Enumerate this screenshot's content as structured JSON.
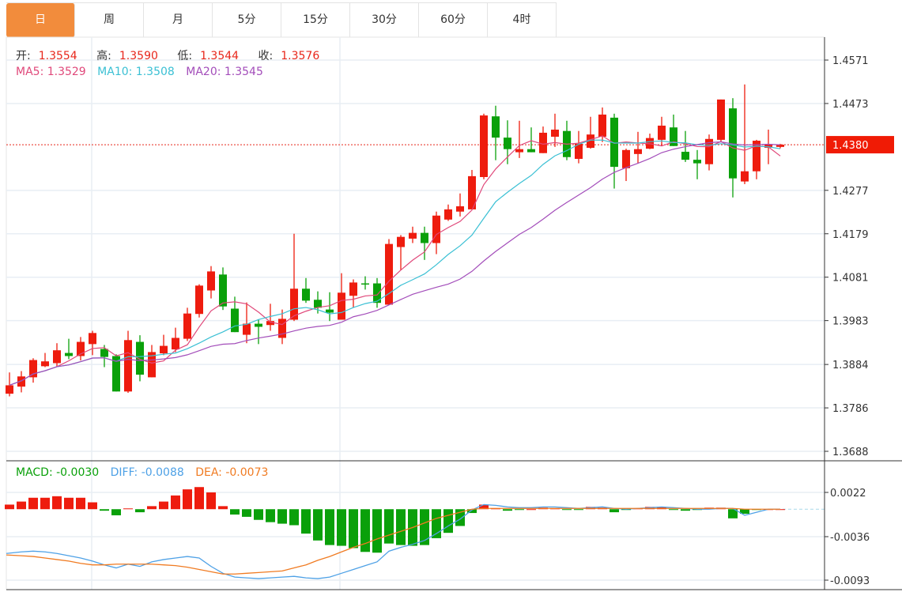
{
  "tabs": [
    {
      "label": "日",
      "active": true
    },
    {
      "label": "周"
    },
    {
      "label": "月"
    },
    {
      "label": "5分"
    },
    {
      "label": "15分"
    },
    {
      "label": "30分"
    },
    {
      "label": "60分"
    },
    {
      "label": "4时"
    }
  ],
  "ohlc_legend": {
    "open_label": "开:",
    "open": "1.3554",
    "high_label": "高:",
    "high": "1.3590",
    "low_label": "低:",
    "low": "1.3544",
    "close_label": "收:",
    "close": "1.3576"
  },
  "ma_legend": {
    "ma5": "MA5: 1.3529",
    "ma10": "MA10: 1.3508",
    "ma20": "MA20: 1.3545"
  },
  "macd_legend": {
    "macd": "MACD: -0.0030",
    "diff": "DIFF: -0.0088",
    "dea": "DEA: -0.0073"
  },
  "colors": {
    "up": "#EE1C0E",
    "down": "#0AA00A",
    "ma5": "#E0487A",
    "ma10": "#3BC0D4",
    "ma20": "#A34DBA",
    "diff": "#4EA1E6",
    "dea": "#F07B22",
    "accent": "#F28C3C"
  },
  "chart_data": [
    {
      "type": "candlestick",
      "title": "",
      "current_price": 1.438,
      "current_price_label": "1.4380",
      "y_ticks": [
        "1.4571",
        "1.4473",
        "1.4277",
        "1.4179",
        "1.4081",
        "1.3983",
        "1.3884",
        "1.3786",
        "1.3688"
      ],
      "ylim": [
        1.3688,
        1.4571
      ],
      "grid": true,
      "ma_periods": [
        5,
        10,
        20
      ],
      "candles": [
        [
          1.3818,
          1.3866,
          1.3812,
          1.3837
        ],
        [
          1.3834,
          1.3869,
          1.3821,
          1.3857
        ],
        [
          1.3855,
          1.3898,
          1.3843,
          1.3894
        ],
        [
          1.388,
          1.391,
          1.3878,
          1.3891
        ],
        [
          1.3887,
          1.3932,
          1.3878,
          1.3916
        ],
        [
          1.391,
          1.3942,
          1.3896,
          1.3903
        ],
        [
          1.3903,
          1.3946,
          1.3893,
          1.3935
        ],
        [
          1.393,
          1.396,
          1.3905,
          1.3955
        ],
        [
          1.3919,
          1.3928,
          1.3878,
          1.3901
        ],
        [
          1.3903,
          1.3907,
          1.3823,
          1.3823
        ],
        [
          1.3823,
          1.396,
          1.382,
          1.3939
        ],
        [
          1.3935,
          1.395,
          1.3846,
          1.3861
        ],
        [
          1.3855,
          1.3928,
          1.3855,
          1.3912
        ],
        [
          1.3909,
          1.3951,
          1.3905,
          1.3926
        ],
        [
          1.3918,
          1.3967,
          1.3912,
          1.3944
        ],
        [
          1.3942,
          1.4012,
          1.3937,
          1.3999
        ],
        [
          1.3998,
          1.4065,
          1.399,
          1.4062
        ],
        [
          1.4051,
          1.4106,
          1.4033,
          1.4094
        ],
        [
          1.4087,
          1.4103,
          1.4007,
          1.4015
        ],
        [
          1.401,
          1.4037,
          1.3957,
          1.3957
        ],
        [
          1.3951,
          1.4024,
          1.3932,
          1.3976
        ],
        [
          1.3976,
          1.3985,
          1.393,
          1.3969
        ],
        [
          1.3973,
          1.4021,
          1.396,
          1.3982
        ],
        [
          1.3944,
          1.4008,
          1.393,
          1.3987
        ],
        [
          1.3985,
          1.4179,
          1.3982,
          1.4055
        ],
        [
          1.4055,
          1.4079,
          1.4023,
          1.4028
        ],
        [
          1.403,
          1.4049,
          1.3999,
          1.4012
        ],
        [
          1.4008,
          1.4047,
          1.3982,
          1.4001
        ],
        [
          1.3985,
          1.409,
          1.3985,
          1.4046
        ],
        [
          1.4039,
          1.4076,
          1.4012,
          1.4069
        ],
        [
          1.4067,
          1.4083,
          1.4053,
          1.4065
        ],
        [
          1.4067,
          1.4079,
          1.4012,
          1.4023
        ],
        [
          1.4019,
          1.4167,
          1.4019,
          1.4156
        ],
        [
          1.4149,
          1.4176,
          1.4097,
          1.4172
        ],
        [
          1.4168,
          1.4195,
          1.4158,
          1.4181
        ],
        [
          1.4181,
          1.4195,
          1.412,
          1.4158
        ],
        [
          1.4158,
          1.4229,
          1.4133,
          1.422
        ],
        [
          1.4211,
          1.4245,
          1.4208,
          1.4234
        ],
        [
          1.4229,
          1.427,
          1.4218,
          1.4241
        ],
        [
          1.4234,
          1.4323,
          1.4234,
          1.4309
        ],
        [
          1.4307,
          1.445,
          1.4302,
          1.4446
        ],
        [
          1.4444,
          1.4468,
          1.4345,
          1.4396
        ],
        [
          1.4396,
          1.4435,
          1.4336,
          1.437
        ],
        [
          1.4363,
          1.4434,
          1.435,
          1.437
        ],
        [
          1.437,
          1.4419,
          1.4363,
          1.4363
        ],
        [
          1.4361,
          1.4421,
          1.4361,
          1.4407
        ],
        [
          1.4398,
          1.445,
          1.4375,
          1.4414
        ],
        [
          1.4411,
          1.4434,
          1.4345,
          1.4352
        ],
        [
          1.4348,
          1.4411,
          1.4338,
          1.4382
        ],
        [
          1.4373,
          1.4443,
          1.4371,
          1.4403
        ],
        [
          1.4398,
          1.4464,
          1.4386,
          1.4448
        ],
        [
          1.4441,
          1.445,
          1.4281,
          1.433
        ],
        [
          1.4327,
          1.4371,
          1.4298,
          1.4368
        ],
        [
          1.4359,
          1.4409,
          1.4338,
          1.437
        ],
        [
          1.4371,
          1.4405,
          1.437,
          1.4395
        ],
        [
          1.4391,
          1.4443,
          1.4377,
          1.4423
        ],
        [
          1.4419,
          1.4448,
          1.4377,
          1.4377
        ],
        [
          1.4364,
          1.4411,
          1.4341,
          1.4346
        ],
        [
          1.4346,
          1.4368,
          1.4302,
          1.4338
        ],
        [
          1.4336,
          1.4403,
          1.4322,
          1.4393
        ],
        [
          1.4391,
          1.4482,
          1.4386,
          1.4482
        ],
        [
          1.4462,
          1.4485,
          1.4261,
          1.4304
        ],
        [
          1.4297,
          1.4516,
          1.4291,
          1.432
        ],
        [
          1.432,
          1.4391,
          1.4302,
          1.4389
        ],
        [
          1.4373,
          1.4414,
          1.4336,
          1.438
        ],
        [
          1.4375,
          1.4382,
          1.4372,
          1.438
        ]
      ]
    },
    {
      "type": "bar+line",
      "title": "MACD",
      "y_ticks": [
        "0.0022",
        "-0.0036",
        "-0.0093"
      ],
      "ylim": [
        -0.0093,
        0.0022
      ],
      "macd": [
        0.0006,
        0.001,
        0.0015,
        0.0015,
        0.0017,
        0.0015,
        0.0015,
        0.0009,
        -0.0002,
        -0.0008,
        0.0001,
        -0.0004,
        0.0004,
        0.001,
        0.0018,
        0.0026,
        0.0029,
        0.0022,
        0.0004,
        -0.0007,
        -0.001,
        -0.0014,
        -0.0017,
        -0.0019,
        -0.0021,
        -0.0032,
        -0.0041,
        -0.0047,
        -0.0048,
        -0.0051,
        -0.0056,
        -0.0057,
        -0.0045,
        -0.0047,
        -0.0048,
        -0.0047,
        -0.0038,
        -0.0031,
        -0.0022,
        -0.0005,
        0.0006,
        0.0001,
        -0.0002,
        -0.0001,
        0.0,
        0.0002,
        0.0001,
        -0.0001,
        -0.0001,
        0.0003,
        0.0002,
        -0.0004,
        -0.0001,
        0.0001,
        0.0003,
        0.0003,
        -0.0001,
        -0.0002,
        -0.0001,
        0.0002,
        0.0002,
        -0.0012,
        -0.0006,
        -0.0001,
        0.0,
        0.0
      ],
      "diff": [
        -0.0058,
        -0.0056,
        -0.0055,
        -0.0056,
        -0.0058,
        -0.0061,
        -0.0064,
        -0.0068,
        -0.0073,
        -0.0077,
        -0.0072,
        -0.0075,
        -0.0069,
        -0.0066,
        -0.0064,
        -0.0062,
        -0.0064,
        -0.0075,
        -0.0084,
        -0.0089,
        -0.009,
        -0.0091,
        -0.009,
        -0.0089,
        -0.0088,
        -0.009,
        -0.0091,
        -0.0089,
        -0.0084,
        -0.0079,
        -0.0074,
        -0.0069,
        -0.0055,
        -0.005,
        -0.0046,
        -0.0041,
        -0.0032,
        -0.0022,
        -0.0013,
        -0.0001,
        0.0006,
        0.0005,
        0.0003,
        0.0002,
        0.0002,
        0.0003,
        0.0003,
        0.0002,
        0.0001,
        0.0002,
        0.0003,
        0.0001,
        0.0,
        0.0001,
        0.0002,
        0.0003,
        0.0002,
        0.0001,
        0.0,
        0.0,
        0.0001,
        0.0001,
        -0.0008,
        -0.0004,
        0.0,
        0.0
      ],
      "dea": [
        -0.006,
        -0.0061,
        -0.0062,
        -0.0064,
        -0.0066,
        -0.0068,
        -0.0071,
        -0.0073,
        -0.0073,
        -0.0072,
        -0.0072,
        -0.0072,
        -0.0072,
        -0.0073,
        -0.0074,
        -0.0076,
        -0.0079,
        -0.0082,
        -0.0085,
        -0.0085,
        -0.0084,
        -0.0083,
        -0.0082,
        -0.0081,
        -0.0077,
        -0.0073,
        -0.0067,
        -0.0062,
        -0.0056,
        -0.005,
        -0.0045,
        -0.0039,
        -0.0034,
        -0.0029,
        -0.0024,
        -0.0018,
        -0.0012,
        -0.0008,
        -0.0004,
        0.0,
        0.0001,
        0.0001,
        0.0001,
        0.0001,
        0.0001,
        0.0001,
        0.0001,
        0.0001,
        0.0001,
        0.0001,
        0.0001,
        0.0001,
        0.0001,
        0.0001,
        0.0001,
        0.0001,
        0.0001,
        0.0001,
        0.0001,
        0.0001,
        0.0001,
        0.0001,
        0.0,
        0.0,
        0.0,
        0.0
      ]
    }
  ]
}
